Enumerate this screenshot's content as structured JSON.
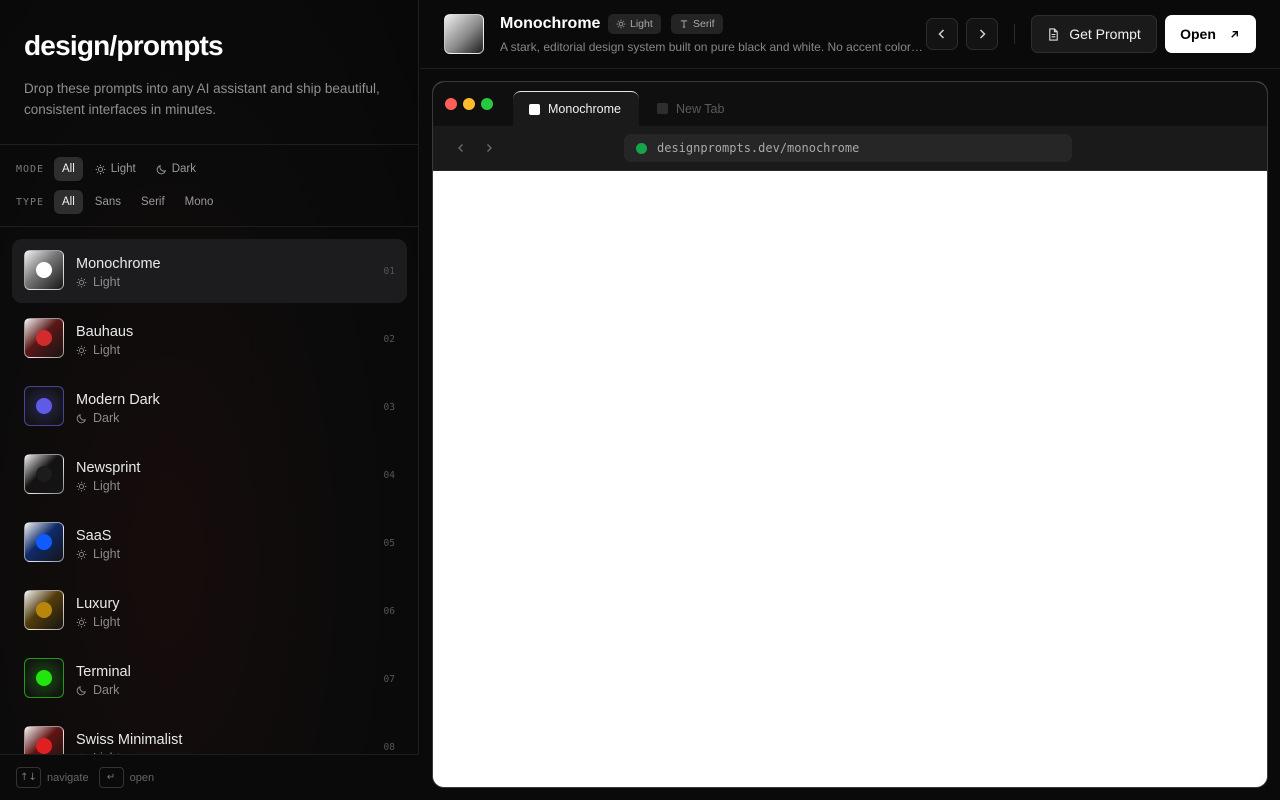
{
  "sidebar": {
    "brand": "design/prompts",
    "tagline": "Drop these prompts into any AI assistant and ship beautiful, consistent interfaces in minutes.",
    "mode_filter": {
      "label": "MODE",
      "options": [
        "All",
        "Light",
        "Dark"
      ],
      "selected": "All"
    },
    "type_filter": {
      "label": "TYPE",
      "options": [
        "All",
        "Sans",
        "Serif",
        "Mono"
      ],
      "selected": "All"
    },
    "items": [
      {
        "name": "Monochrome",
        "mode": "Light",
        "number": "01",
        "accent": "#ffffff",
        "selected": true
      },
      {
        "name": "Bauhaus",
        "mode": "Light",
        "number": "02",
        "accent": "#d12b2b"
      },
      {
        "name": "Modern Dark",
        "mode": "Dark",
        "number": "03",
        "accent": "#5e5ce6"
      },
      {
        "name": "Newsprint",
        "mode": "Light",
        "number": "04",
        "accent": "#1c1c1c"
      },
      {
        "name": "SaaS",
        "mode": "Light",
        "number": "05",
        "accent": "#0f5bff"
      },
      {
        "name": "Luxury",
        "mode": "Light",
        "number": "06",
        "accent": "#b8860b"
      },
      {
        "name": "Terminal",
        "mode": "Dark",
        "number": "07",
        "accent": "#22e40f"
      },
      {
        "name": "Swiss Minimalist",
        "mode": "Light",
        "number": "08",
        "accent": "#e02020"
      }
    ],
    "footer": {
      "navigate_label": "navigate",
      "open_label": "open",
      "navigate_key": "↑↓",
      "open_key": "↵"
    }
  },
  "header": {
    "title": "Monochrome",
    "mode_badge": "Light",
    "font_badge": "Serif",
    "description": "A stark, editorial design system built on pure black and white. No accent colors, just contrast, rhythm and typography.",
    "get_prompt_label": "Get Prompt",
    "open_label": "Open"
  },
  "browser": {
    "active_tab": "Monochrome",
    "inactive_tab": "New Tab",
    "url": "designprompts.dev/monochrome"
  },
  "colors": {
    "traffic_red": "#ff5f57",
    "traffic_yellow": "#febc2e",
    "traffic_green": "#28c840",
    "secure_dot": "#16a34a"
  }
}
